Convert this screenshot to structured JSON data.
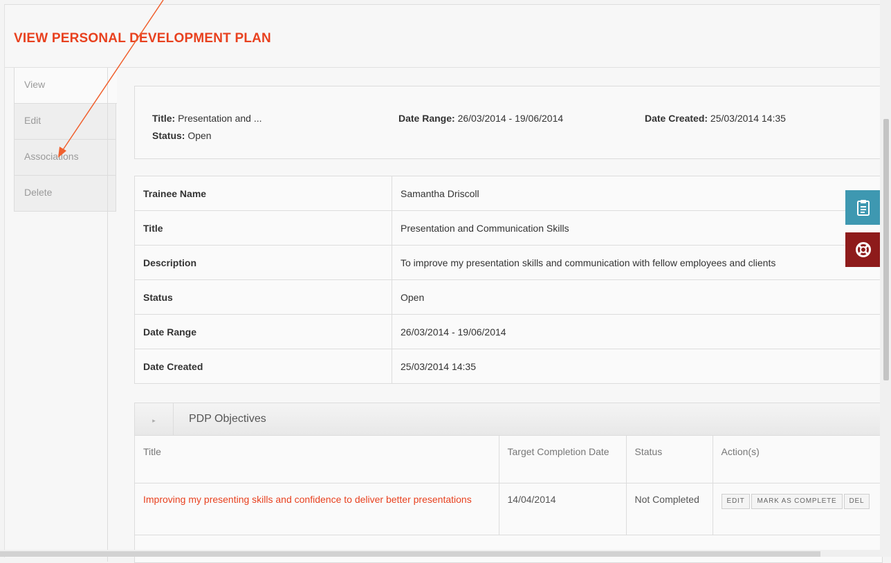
{
  "page": {
    "title": "VIEW PERSONAL DEVELOPMENT PLAN"
  },
  "tabs": [
    {
      "label": "View",
      "active": true
    },
    {
      "label": "Edit"
    },
    {
      "label": "Associations"
    },
    {
      "label": "Delete"
    }
  ],
  "summary": {
    "title_label": "Title:",
    "title_value": "Presentation and ...",
    "status_label": "Status:",
    "status_value": "Open",
    "range_label": "Date Range:",
    "range_value": "26/03/2014 - 19/06/2014",
    "created_label": "Date Created:",
    "created_value": "25/03/2014 14:35"
  },
  "details": [
    {
      "key": "Trainee Name",
      "value": "Samantha Driscoll"
    },
    {
      "key": "Title",
      "value": "Presentation and Communication Skills"
    },
    {
      "key": "Description",
      "value": "To improve my presentation skills and communication with fellow employees and clients"
    },
    {
      "key": "Status",
      "value": "Open"
    },
    {
      "key": "Date Range",
      "value": "26/03/2014 - 19/06/2014"
    },
    {
      "key": "Date Created",
      "value": "25/03/2014 14:35"
    }
  ],
  "objectives": {
    "toggle_icon": "▸",
    "heading": "PDP Objectives",
    "columns": [
      "Title",
      "Target Completion Date",
      "Status",
      "Action(s)"
    ],
    "rows": [
      {
        "title": "Improving my presenting skills and confidence to deliver better presentations",
        "target": "14/04/2014",
        "status": "Not Completed",
        "actions": [
          "EDIT",
          "MARK AS COMPLETE",
          "DEL"
        ]
      }
    ]
  },
  "floating": {
    "notes_icon": "clipboard-icon",
    "help_icon": "lifebuoy-icon",
    "notes_color": "#3e98b1",
    "help_color": "#8e1b1b"
  },
  "colors": {
    "accent": "#e8411f"
  }
}
